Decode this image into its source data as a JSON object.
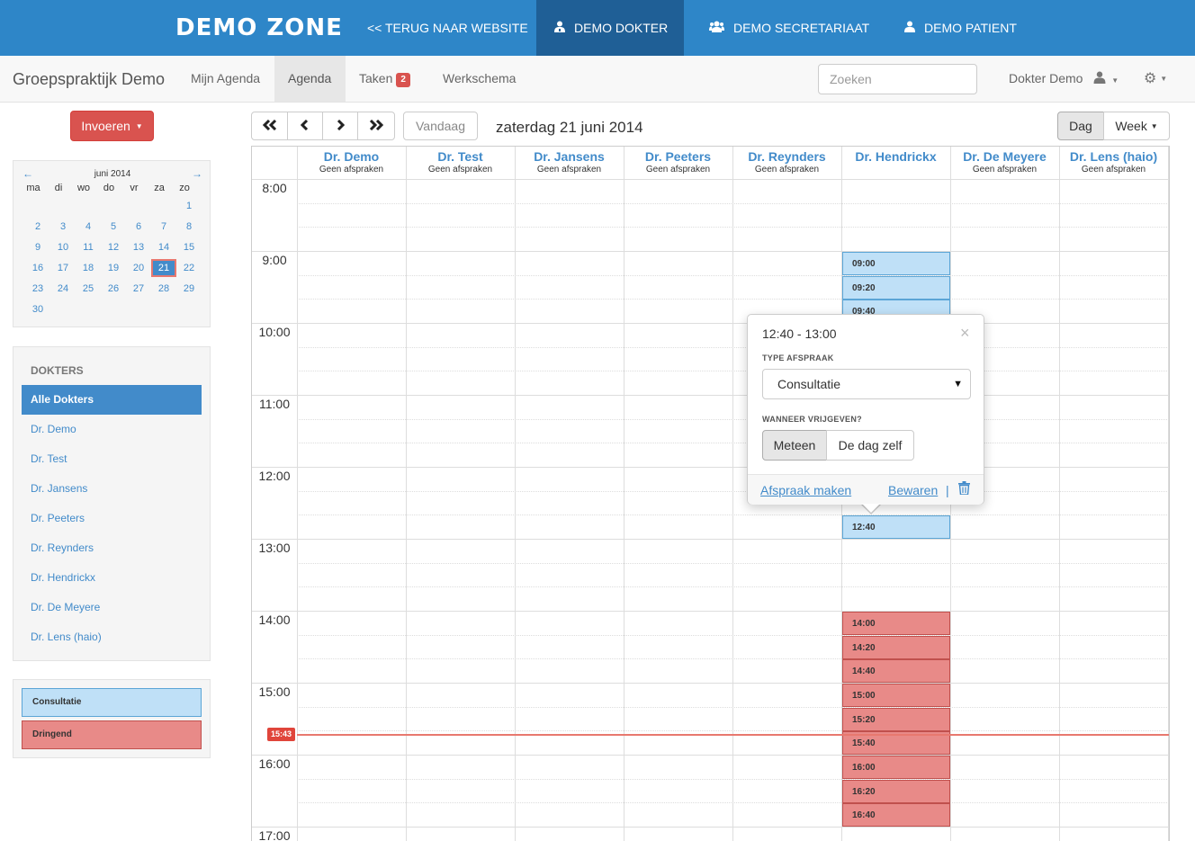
{
  "topbar": {
    "brand": "DEMO ZONE",
    "links": [
      {
        "label": "<< TERUG NAAR WEBSITE",
        "icon": "back"
      },
      {
        "label": "DEMO DOKTER",
        "icon": "user-md-icon"
      },
      {
        "label": "DEMO SECRETARIAAT",
        "icon": "users-icon"
      },
      {
        "label": "DEMO PATIENT",
        "icon": "user-icon"
      }
    ]
  },
  "subnav": {
    "practice": "Groepspraktijk Demo",
    "tabs": [
      "Mijn Agenda",
      "Agenda",
      "Taken",
      "Werkschema"
    ],
    "taken_badge": "2",
    "search_placeholder": "Zoeken",
    "user": "Dokter Demo"
  },
  "sidebar": {
    "invoeren": "Invoeren",
    "calendar": {
      "month": "juni 2014",
      "prev": "←",
      "next": "→",
      "weekdays": [
        "ma",
        "di",
        "wo",
        "do",
        "vr",
        "za",
        "zo"
      ],
      "weeks": [
        [
          "",
          "",
          "",
          "",
          "",
          "",
          "1"
        ],
        [
          "2",
          "3",
          "4",
          "5",
          "6",
          "7",
          "8"
        ],
        [
          "9",
          "10",
          "11",
          "12",
          "13",
          "14",
          "15"
        ],
        [
          "16",
          "17",
          "18",
          "19",
          "20",
          "21",
          "22"
        ],
        [
          "23",
          "24",
          "25",
          "26",
          "27",
          "28",
          "29"
        ],
        [
          "30",
          "",
          "",
          "",
          "",
          "",
          ""
        ]
      ],
      "selected": "21"
    },
    "doctors_title": "DOKTERS",
    "doctors": [
      "Alle Dokters",
      "Dr. Demo",
      "Dr. Test",
      "Dr. Jansens",
      "Dr. Peeters",
      "Dr. Reynders",
      "Dr. Hendrickx",
      "Dr. De Meyere",
      "Dr. Lens (haio)"
    ],
    "legend": [
      {
        "label": "Consultatie",
        "color": "#bfe0f7"
      },
      {
        "label": "Dringend",
        "color": "#e88a88"
      }
    ]
  },
  "toolbar": {
    "vandaag": "Vandaag",
    "date": "zaterdag 21 juni 2014",
    "view_day": "Dag",
    "view_week": "Week"
  },
  "agenda": {
    "columns": [
      {
        "name": "Dr. Demo",
        "sub": "Geen afspraken"
      },
      {
        "name": "Dr. Test",
        "sub": "Geen afspraken"
      },
      {
        "name": "Dr. Jansens",
        "sub": "Geen afspraken"
      },
      {
        "name": "Dr. Peeters",
        "sub": "Geen afspraken"
      },
      {
        "name": "Dr. Reynders",
        "sub": "Geen afspraken"
      },
      {
        "name": "Dr. Hendrickx",
        "sub": ""
      },
      {
        "name": "Dr. De Meyere",
        "sub": "Geen afspraken"
      },
      {
        "name": "Dr. Lens (haio)",
        "sub": "Geen afspraken"
      }
    ],
    "hours": [
      "8:00",
      "9:00",
      "10:00",
      "11:00",
      "12:00",
      "13:00",
      "14:00",
      "15:00",
      "16:00",
      "17:00"
    ],
    "appointments_consultatie": [
      "09:00",
      "09:20",
      "09:40",
      "12:40"
    ],
    "appointments_dringend": [
      "14:00",
      "14:20",
      "14:40",
      "15:00",
      "15:20",
      "15:40",
      "16:00",
      "16:20",
      "16:40"
    ],
    "now_time": "15:43"
  },
  "popover": {
    "time": "12:40 - 13:00",
    "close": "×",
    "type_label": "TYPE AFSPRAAK",
    "type_value": "Consultatie",
    "release_label": "WANNEER VRIJGEVEN?",
    "release_options": [
      "Meteen",
      "De dag zelf"
    ],
    "afspraak_maken": "Afspraak maken",
    "bewaren": "Bewaren",
    "separator": "|"
  }
}
